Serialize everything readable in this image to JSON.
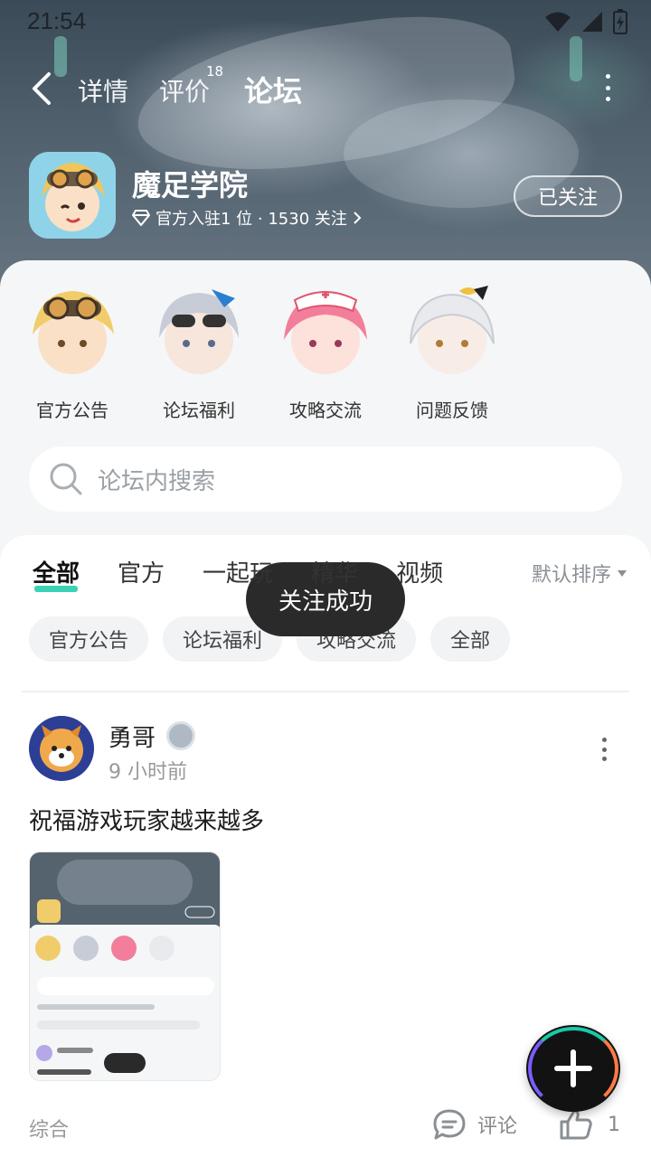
{
  "status_bar": {
    "time": "21:54"
  },
  "nav": {
    "tabs": [
      {
        "label": "详情"
      },
      {
        "label": "评价",
        "count": "18"
      },
      {
        "label": "论坛"
      }
    ]
  },
  "game": {
    "name": "魔足学院",
    "meta": "官方入驻1 位 · 1530 关注",
    "follow_label": "已关注"
  },
  "sections": [
    {
      "label": "官方公告"
    },
    {
      "label": "论坛福利"
    },
    {
      "label": "攻略交流"
    },
    {
      "label": "问题反馈"
    }
  ],
  "search": {
    "placeholder": "论坛内搜索"
  },
  "feed": {
    "tabs": [
      "全部",
      "官方",
      "一起玩",
      "精华",
      "视频"
    ],
    "sort_label": "默认排序",
    "chips": [
      "官方公告",
      "论坛福利",
      "攻略交流",
      "全部"
    ]
  },
  "post": {
    "author": "勇哥",
    "time": "9 小时前",
    "text": "祝福游戏玩家越来越多",
    "tag": "综合",
    "comment_label": "评论",
    "like_count": "1"
  },
  "toast": {
    "message": "关注成功"
  },
  "colors": {
    "accent": "#19c9a8"
  },
  "icons": [
    "back-arrow-icon",
    "more-vertical-icon",
    "diamond-icon",
    "chevron-right-icon",
    "search-icon",
    "caret-down-icon",
    "comment-icon",
    "thumbs-up-icon",
    "plus-icon",
    "wifi-icon",
    "signal-icon",
    "battery-icon"
  ]
}
